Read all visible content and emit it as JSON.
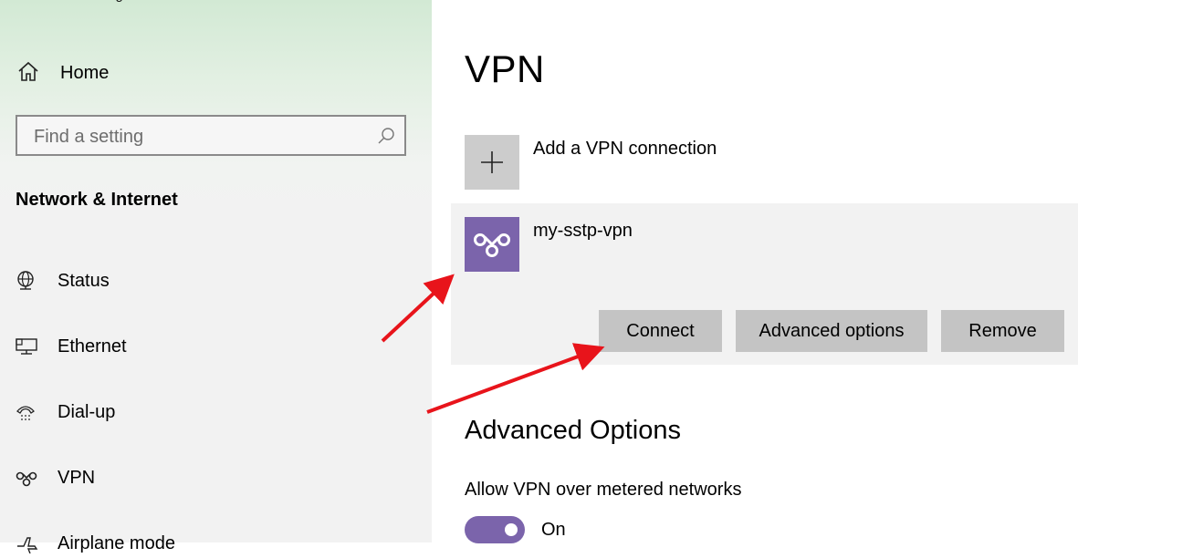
{
  "app": {
    "title": "Settings"
  },
  "sidebar": {
    "home_label": "Home",
    "search": {
      "placeholder": "Find a setting",
      "value": ""
    },
    "section_title": "Network & Internet",
    "items": [
      {
        "label": "Status",
        "icon": "globe-monitor-icon"
      },
      {
        "label": "Ethernet",
        "icon": "ethernet-monitor-icon"
      },
      {
        "label": "Dial-up",
        "icon": "phone-icon"
      },
      {
        "label": "VPN",
        "icon": "vpn-icon"
      },
      {
        "label": "Airplane mode",
        "icon": "airplane-icon"
      }
    ]
  },
  "main": {
    "page_title": "VPN",
    "add_connection_label": "Add a VPN connection",
    "connection": {
      "name": "my-sstp-vpn",
      "buttons": {
        "connect": "Connect",
        "advanced": "Advanced options",
        "remove": "Remove"
      }
    },
    "advanced_section_title": "Advanced Options",
    "metered_option": {
      "label": "Allow VPN over metered networks",
      "state": "On",
      "enabled": true
    }
  },
  "colors": {
    "accent": "#7b64ab",
    "annotation_arrow": "#e8141b",
    "tile_gray": "#cccccc",
    "button_gray": "#c4c4c4",
    "card_bg": "#f2f2f2"
  }
}
